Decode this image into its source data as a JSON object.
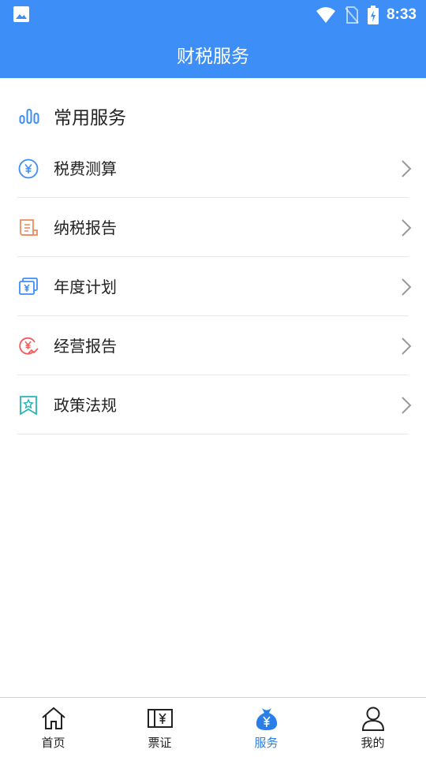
{
  "status_bar": {
    "time": "8:33",
    "icons": [
      "image-icon",
      "wifi-icon",
      "no-sim-icon",
      "battery-charging-icon"
    ]
  },
  "app_bar": {
    "title": "财税服务"
  },
  "section": {
    "title": "常用服务",
    "icon": "bar-chart-icon"
  },
  "services": [
    {
      "label": "税费测算",
      "icon": "yuan-circle-icon",
      "color": "#3d8ef7"
    },
    {
      "label": "纳税报告",
      "icon": "scroll-document-icon",
      "color": "#f08a5d"
    },
    {
      "label": "年度计划",
      "icon": "yuan-cards-icon",
      "color": "#3d8ef7"
    },
    {
      "label": "经营报告",
      "icon": "yuan-trend-icon",
      "color": "#f25b5b"
    },
    {
      "label": "政策法规",
      "icon": "star-bookmark-icon",
      "color": "#26b5b5"
    }
  ],
  "tabs": [
    {
      "label": "首页",
      "icon": "home-icon",
      "active": false
    },
    {
      "label": "票证",
      "icon": "ticket-yuan-icon",
      "active": false
    },
    {
      "label": "服务",
      "icon": "money-bag-icon",
      "active": true
    },
    {
      "label": "我的",
      "icon": "user-icon",
      "active": false
    }
  ],
  "colors": {
    "primary": "#3d8ef7",
    "active_tab": "#2a7ee8",
    "divider": "#e8e8e8"
  }
}
